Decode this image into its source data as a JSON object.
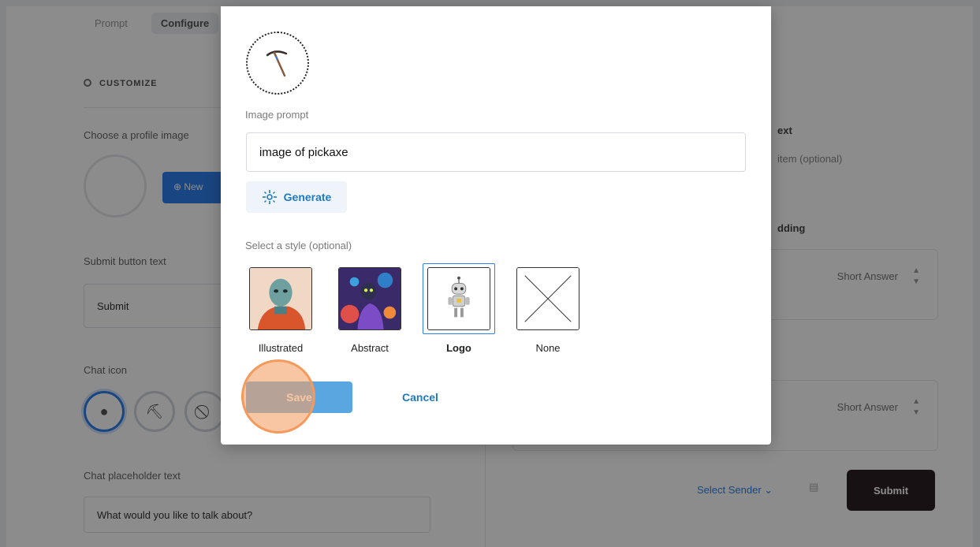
{
  "background": {
    "tabs": [
      "Prompt",
      "Configure"
    ],
    "section_title": "CUSTOMIZE",
    "profile_image_label": "Choose a profile image",
    "new_button_label": "New",
    "submit_text_label": "Submit button text",
    "submit_text_value": "Submit",
    "chat_icon_label": "Chat icon",
    "placeholder_label": "Chat placeholder text",
    "placeholder_value": "What would you like to talk about?",
    "right_heading": "ext",
    "right_sub": "item (optional)",
    "right_heading2": "dding",
    "short_answer_1": "Short Answer",
    "short_answer_2": "Short Answer",
    "select_sender": "Select Sender",
    "submit_button": "Submit"
  },
  "modal": {
    "prompt_label": "Image prompt",
    "prompt_value": "image of pickaxe",
    "generate_label": "Generate",
    "style_label": "Select a style (optional)",
    "styles": [
      {
        "label": "Illustrated"
      },
      {
        "label": "Abstract"
      },
      {
        "label": "Logo"
      },
      {
        "label": "None"
      }
    ],
    "selected_style": "Logo",
    "save_label": "Save",
    "cancel_label": "Cancel"
  },
  "colors": {
    "accent": "#1f7ac0",
    "save_button": "#5aa6e0",
    "click_highlight": "#f49a5c"
  }
}
